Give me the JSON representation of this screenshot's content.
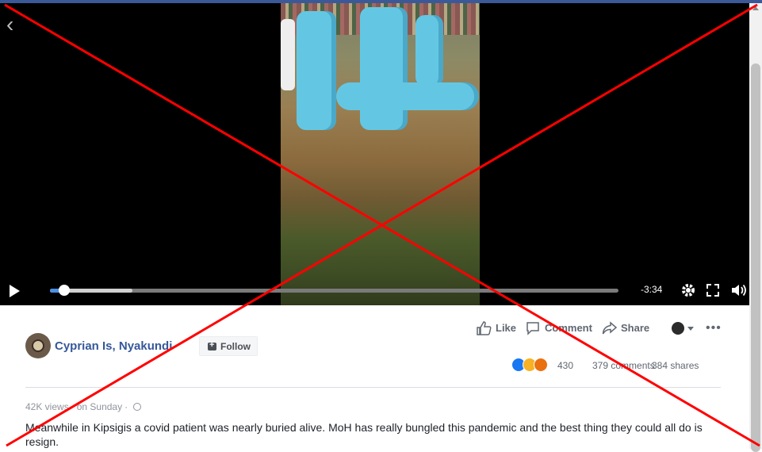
{
  "video": {
    "time_remaining": "-3:34",
    "progress": 0.025,
    "buffered": 0.145
  },
  "post": {
    "author_name": "Cyprian Is, Nyakundi",
    "follow_label": "Follow",
    "actions": {
      "like": "Like",
      "comment": "Comment",
      "share": "Share"
    },
    "reaction_count": "430",
    "comments": "379 comments",
    "shares": "384 shares",
    "views": "42K views",
    "posted": "on Sunday",
    "caption": "Meanwhile in Kipsigis a covid patient was nearly buried alive. MoH has really bungled this pandemic and the best thing they could all do is resign."
  },
  "icons": [
    "back-arrow-icon",
    "play-icon",
    "settings-gear-icon",
    "fullscreen-icon",
    "volume-icon",
    "like-thumb-icon",
    "comment-bubble-icon",
    "share-arrow-icon",
    "more-dots-icon",
    "globe-icon",
    "like-reaction-icon",
    "sad-reaction-icon",
    "angry-reaction-icon"
  ],
  "colors": {
    "brand": "#3b5998",
    "link": "#365899",
    "progress": "#4a90e2",
    "cross": "#ff0000"
  }
}
